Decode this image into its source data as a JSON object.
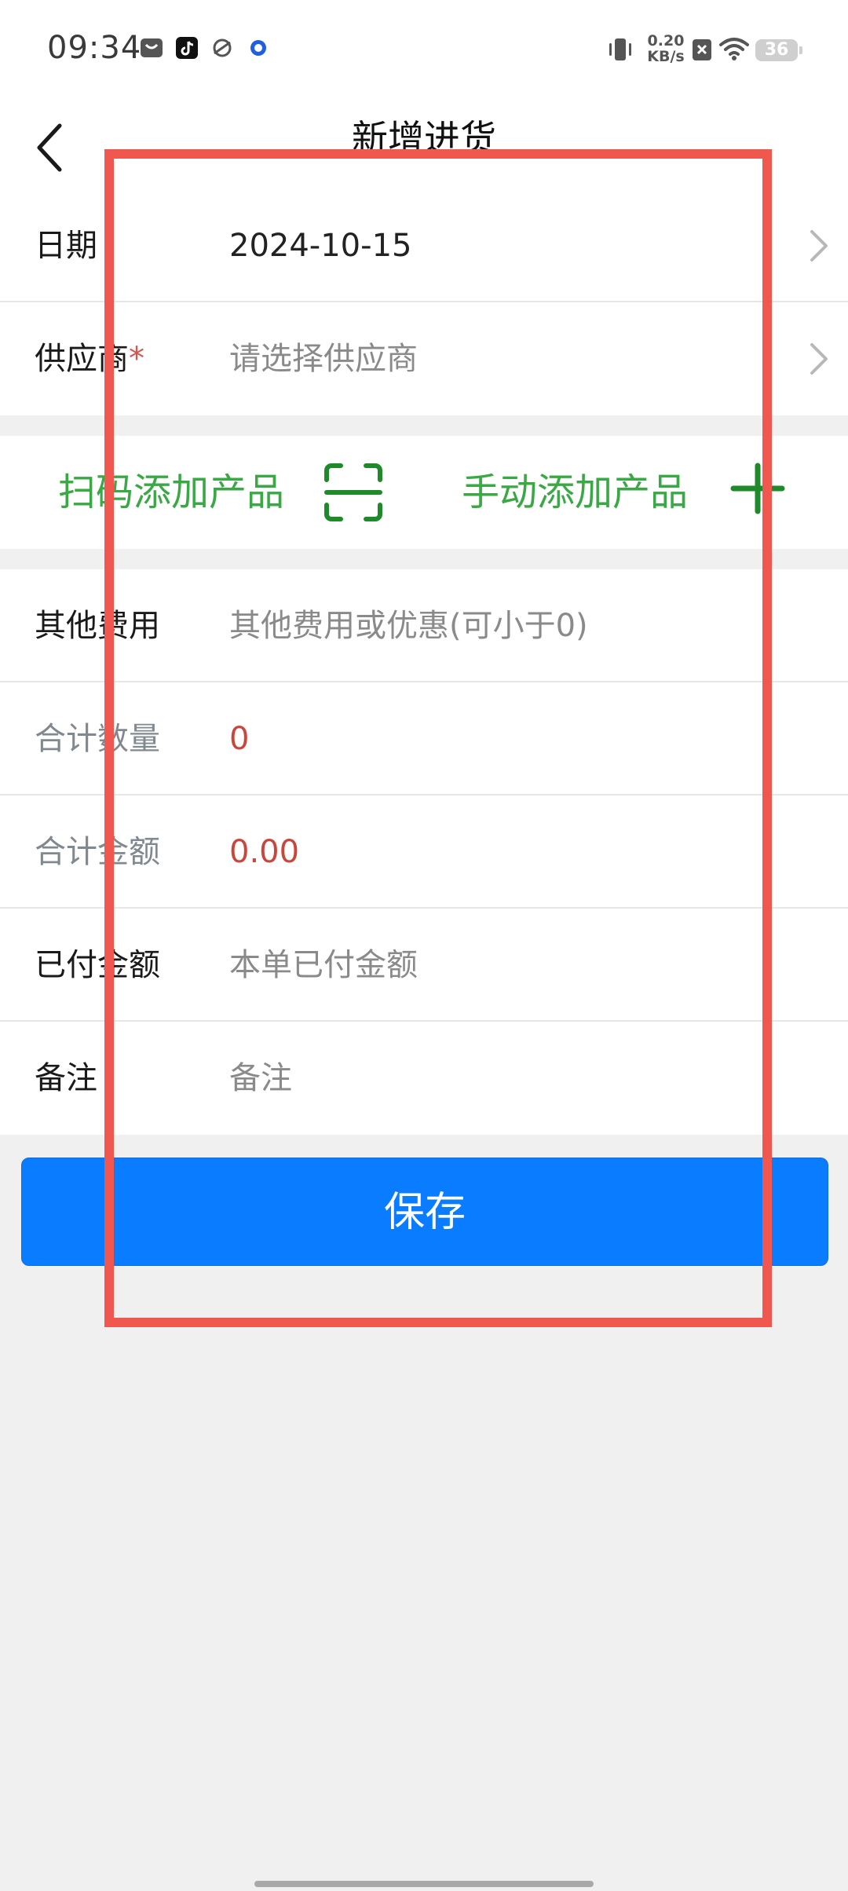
{
  "status_bar": {
    "time": "09:34",
    "net_speed_value": "0.20",
    "net_speed_unit": "KB/s",
    "battery": "36",
    "icons": [
      "mail-icon",
      "tiktok-icon",
      "browser-icon",
      "blue-dot-icon",
      "vibrate-icon",
      "sim-x-icon",
      "wifi-icon",
      "battery-icon"
    ]
  },
  "header": {
    "title": "新增进货",
    "back_icon": "chevron-left-icon"
  },
  "form_top": {
    "date": {
      "label": "日期",
      "value": "2024-10-15"
    },
    "supplier": {
      "label": "供应商",
      "required_mark": "*",
      "placeholder": "请选择供应商"
    }
  },
  "add_product": {
    "scan_label": "扫码添加产品",
    "scan_icon": "scan-icon",
    "manual_label": "手动添加产品",
    "manual_icon": "plus-icon",
    "accent_color": "#3aa845",
    "icon_color": "#1f8a2a"
  },
  "form_bottom": {
    "other_fee": {
      "label": "其他费用",
      "placeholder": "其他费用或优惠(可小于0)"
    },
    "total_qty": {
      "label": "合计数量",
      "value": "0"
    },
    "total_amount": {
      "label": "合计金额",
      "value": "0.00"
    },
    "paid_amount": {
      "label": "已付金额",
      "placeholder": "本单已付金额"
    },
    "remark": {
      "label": "备注",
      "placeholder": "备注"
    }
  },
  "save_button": {
    "label": "保存",
    "color": "#0a7cff"
  },
  "highlight": {
    "color": "#f0574f"
  }
}
